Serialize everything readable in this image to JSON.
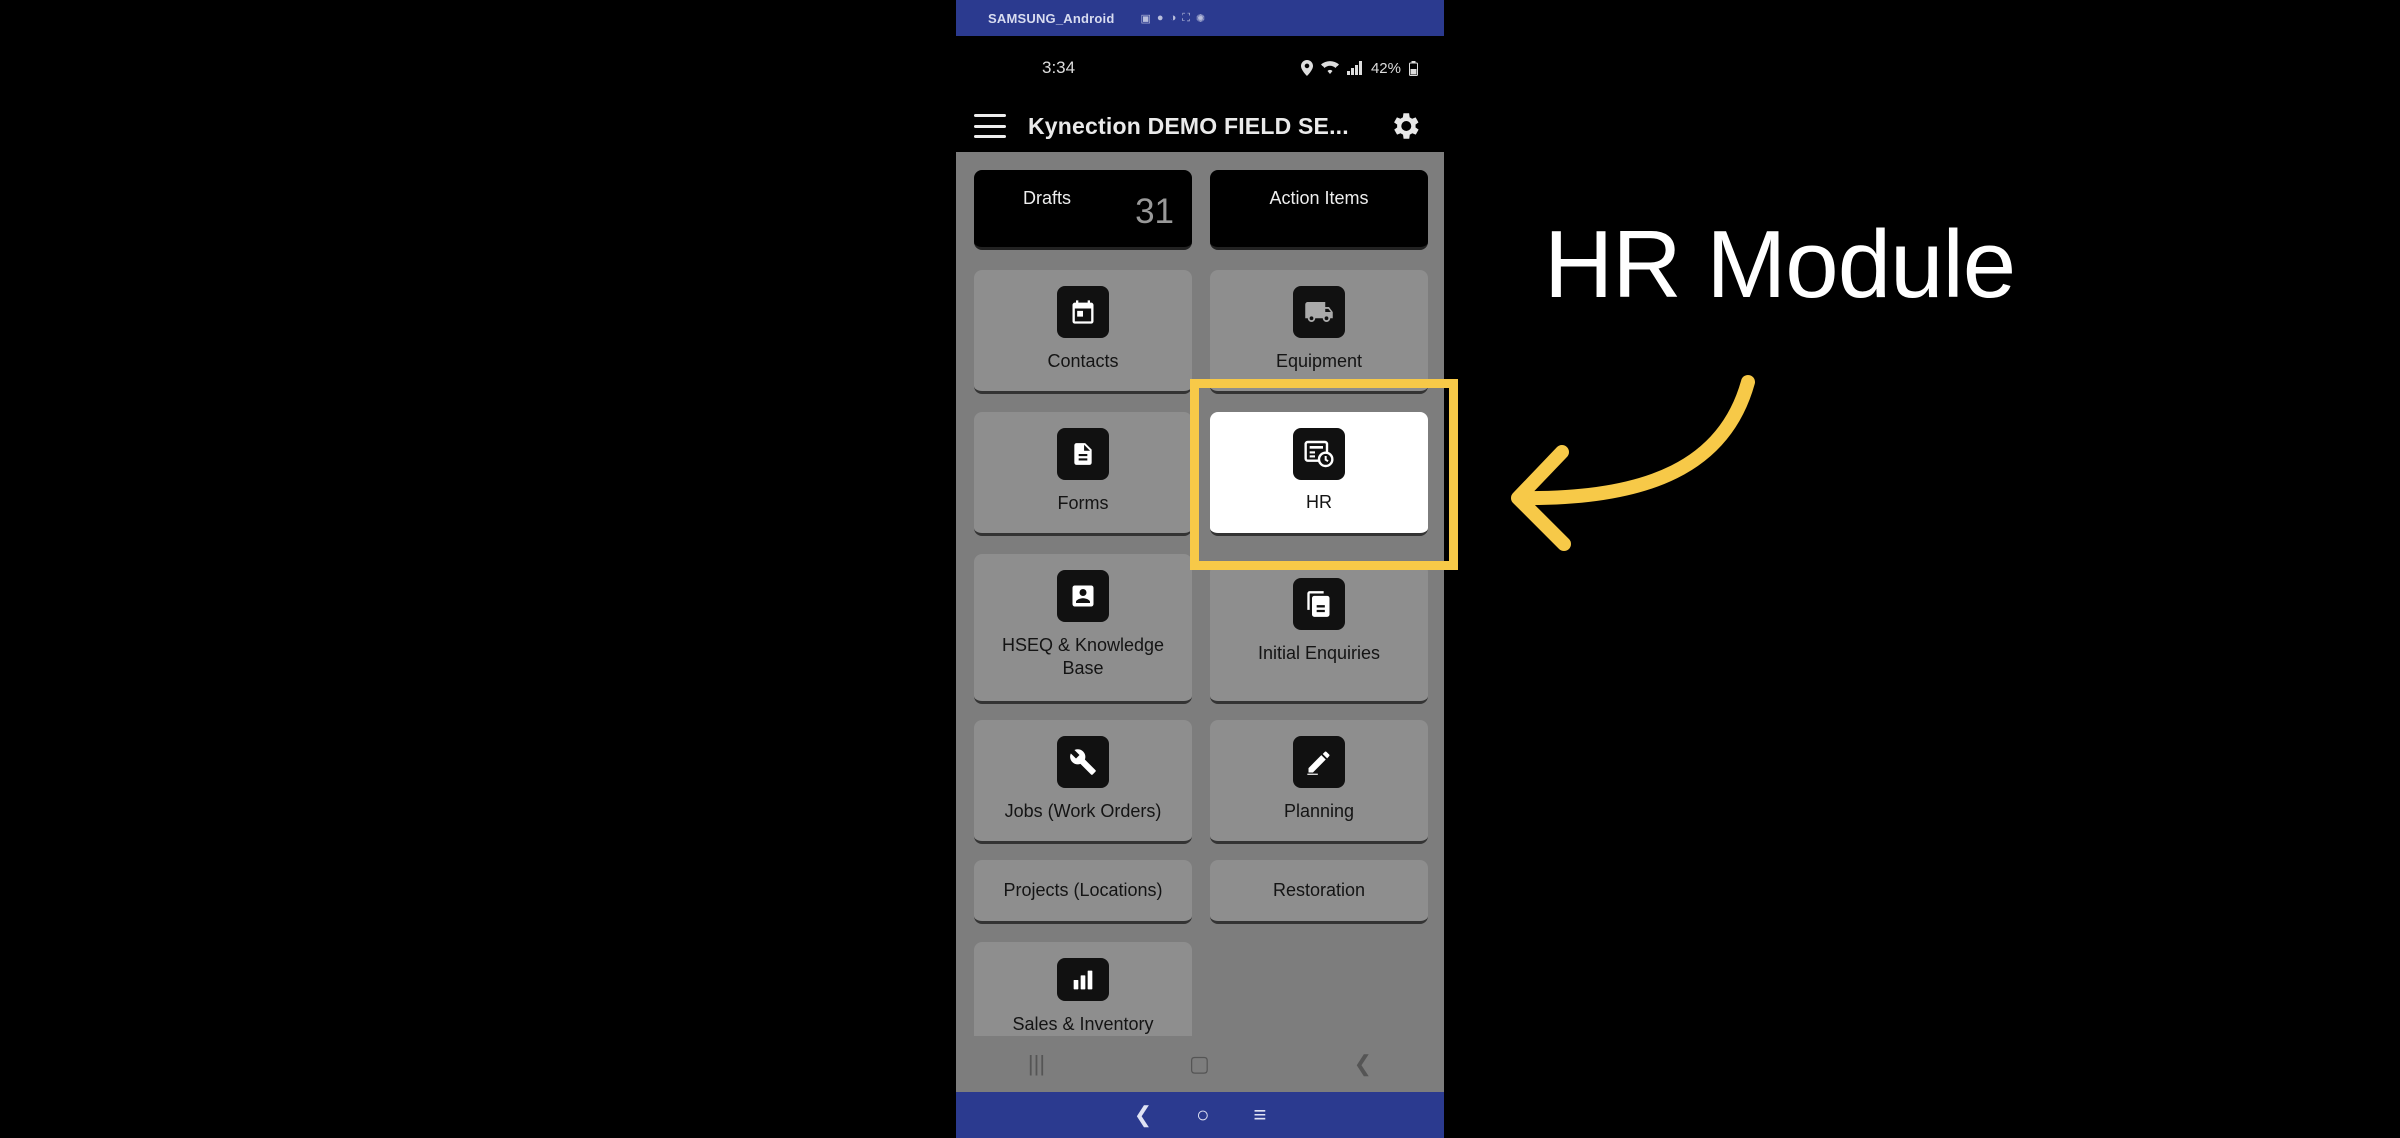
{
  "mirror": {
    "device_name": "SAMSUNG_Android",
    "bar_color": "#2b3a8f"
  },
  "status": {
    "time": "3:34",
    "battery": "42%"
  },
  "app_bar": {
    "title": "Kynection DEMO FIELD SE..."
  },
  "counters": [
    {
      "label": "Drafts",
      "value": "31"
    },
    {
      "label": "Action Items",
      "value": ""
    }
  ],
  "tiles": {
    "contacts": "Contacts",
    "equipment": "Equipment",
    "forms": "Forms",
    "hr": "HR",
    "hseq": "HSEQ & Knowledge Base",
    "initial_enquiries": "Initial Enquiries",
    "jobs": "Jobs (Work Orders)",
    "planning": "Planning",
    "projects": "Projects (Locations)",
    "restoration": "Restoration",
    "sales": "Sales & Inventory"
  },
  "annotation": {
    "title": "HR Module",
    "accent_color": "#f7c948"
  }
}
